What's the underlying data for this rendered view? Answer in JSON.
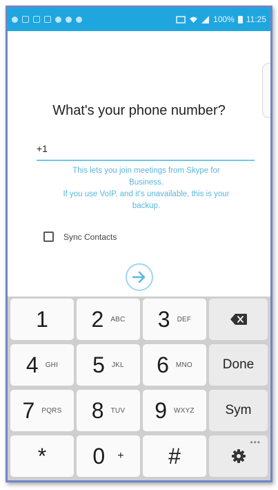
{
  "status_bar": {
    "battery": "100%",
    "time": "11:25"
  },
  "page": {
    "title": "What's your phone number?",
    "phone_value": "+1",
    "helper_text_line1": "This lets you join meetings from Skype for",
    "helper_text_line2": "Business.",
    "helper_text_line3": "If you use VoIP, and it's unavailable, this is your",
    "helper_text_line4": "backup.",
    "sync_contacts_label": "Sync Contacts",
    "sync_contacts_checked": false
  },
  "keypad": {
    "keys": [
      {
        "digit": "1",
        "letters": ""
      },
      {
        "digit": "2",
        "letters": "ABC"
      },
      {
        "digit": "3",
        "letters": "DEF"
      },
      {
        "digit": "4",
        "letters": "GHI"
      },
      {
        "digit": "5",
        "letters": "JKL"
      },
      {
        "digit": "6",
        "letters": "MNO"
      },
      {
        "digit": "7",
        "letters": "PQRS"
      },
      {
        "digit": "8",
        "letters": "TUV"
      },
      {
        "digit": "9",
        "letters": "WXYZ"
      },
      {
        "digit": "*",
        "letters": ""
      },
      {
        "digit": "0",
        "letters": "+"
      },
      {
        "digit": "#",
        "letters": ""
      }
    ],
    "done_label": "Done",
    "sym_label": "Sym",
    "backspace_icon": "backspace-icon",
    "settings_icon": "gear-icon"
  },
  "colors": {
    "status_bar": "#20a6df",
    "accent": "#59b6dc",
    "keypad_bg": "#cfcfcf"
  }
}
